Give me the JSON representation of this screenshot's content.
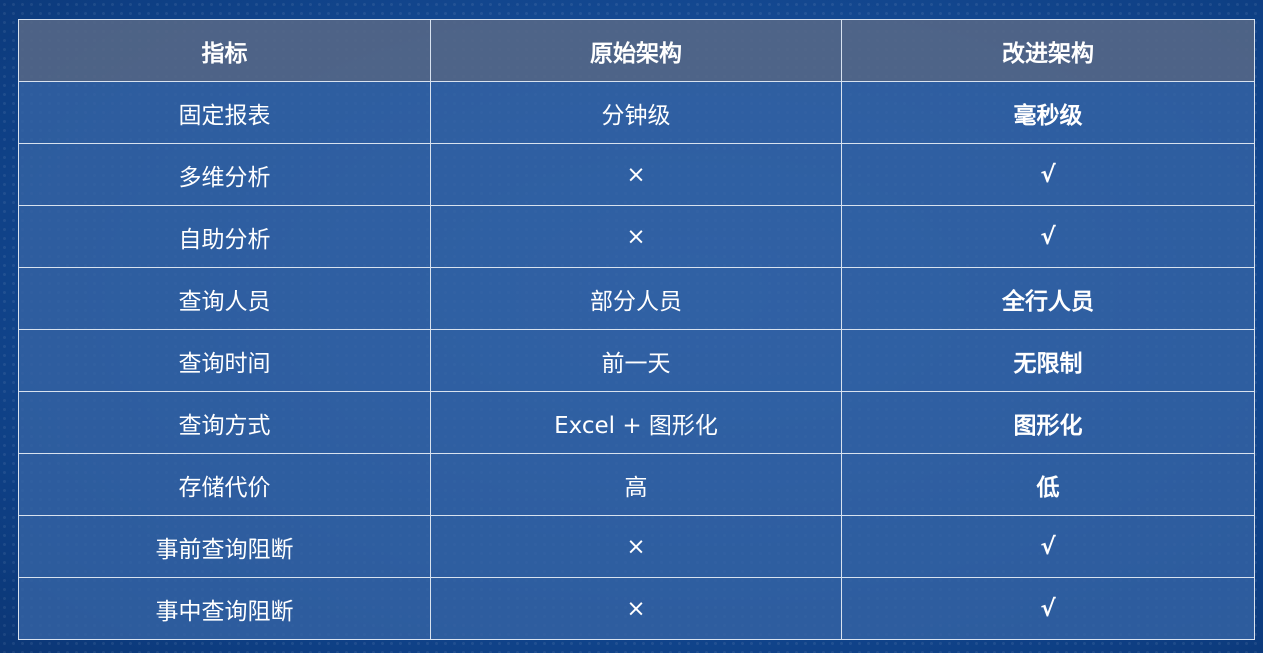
{
  "table": {
    "headers": [
      "指标",
      "原始架构",
      "改进架构"
    ],
    "rows": [
      {
        "metric": "固定报表",
        "original": "分钟级",
        "improved": "毫秒级"
      },
      {
        "metric": "多维分析",
        "original": "×",
        "improved": "√"
      },
      {
        "metric": "自助分析",
        "original": "×",
        "improved": "√"
      },
      {
        "metric": "查询人员",
        "original": "部分人员",
        "improved": "全行人员"
      },
      {
        "metric": "查询时间",
        "original": "前一天",
        "improved": "无限制"
      },
      {
        "metric": "查询方式",
        "original": "Excel + 图形化",
        "improved": "图形化"
      },
      {
        "metric": "存储代价",
        "original": "高",
        "improved": "低"
      },
      {
        "metric": "事前查询阻断",
        "original": "×",
        "improved": "√"
      },
      {
        "metric": "事中查询阻断",
        "original": "×",
        "improved": "√"
      }
    ]
  },
  "colors": {
    "improved_text": "#f2b04c",
    "header_bg": "#566886",
    "row_bg": "#3463a3",
    "page_bg": "#164c96"
  }
}
